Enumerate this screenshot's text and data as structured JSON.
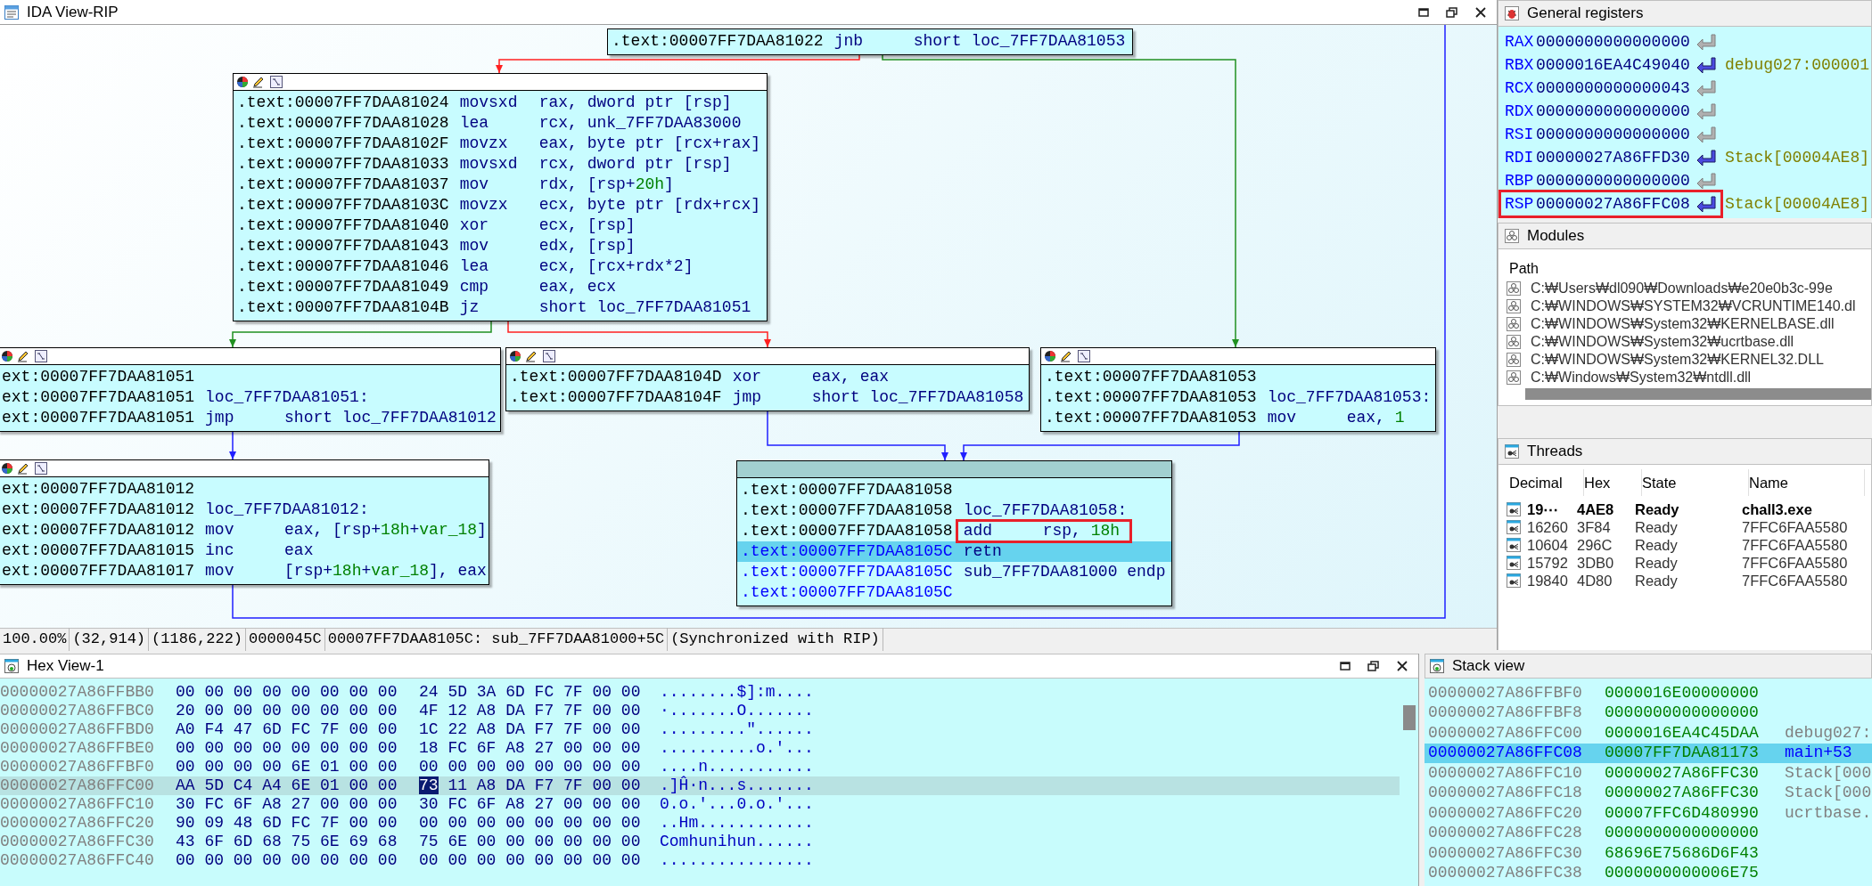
{
  "ida_view": {
    "title": "IDA View-RIP",
    "graph": {
      "nodes": [
        {
          "header": false,
          "lines": [
            {
              "address": ".text:00007FF7DAA81022",
              "mnemonic": "jnb",
              "operands": [
                {
                  "text": "short loc_7FF7DAA81053"
                }
              ]
            }
          ]
        },
        {
          "header": true,
          "lines": [
            {
              "address": ".text:00007FF7DAA81024",
              "mnemonic": "movsxd",
              "operands": [
                {
                  "text": "rax, dword ptr [rsp]"
                }
              ]
            },
            {
              "address": ".text:00007FF7DAA81028",
              "mnemonic": "lea",
              "operands": [
                {
                  "text": "rcx, unk_7FF7DAA83000"
                }
              ]
            },
            {
              "address": ".text:00007FF7DAA8102F",
              "mnemonic": "movzx",
              "operands": [
                {
                  "text": "eax, byte ptr [rcx+rax]"
                }
              ]
            },
            {
              "address": ".text:00007FF7DAA81033",
              "mnemonic": "movsxd",
              "operands": [
                {
                  "text": "rcx, dword ptr [rsp]"
                }
              ]
            },
            {
              "address": ".text:00007FF7DAA81037",
              "mnemonic": "mov",
              "operands": [
                {
                  "text": "rdx, [rsp+"
                },
                {
                  "text": "20h",
                  "kind": "number"
                },
                {
                  "text": "]"
                }
              ]
            },
            {
              "address": ".text:00007FF7DAA8103C",
              "mnemonic": "movzx",
              "operands": [
                {
                  "text": "ecx, byte ptr [rdx+rcx]"
                }
              ]
            },
            {
              "address": ".text:00007FF7DAA81040",
              "mnemonic": "xor",
              "operands": [
                {
                  "text": "ecx, [rsp]"
                }
              ]
            },
            {
              "address": ".text:00007FF7DAA81043",
              "mnemonic": "mov",
              "operands": [
                {
                  "text": "edx, [rsp]"
                }
              ]
            },
            {
              "address": ".text:00007FF7DAA81046",
              "mnemonic": "lea",
              "operands": [
                {
                  "text": "ecx, [rcx+rdx*2]"
                }
              ]
            },
            {
              "address": ".text:00007FF7DAA81049",
              "mnemonic": "cmp",
              "operands": [
                {
                  "text": "eax, ecx"
                }
              ]
            },
            {
              "address": ".text:00007FF7DAA8104B",
              "mnemonic": "jz",
              "operands": [
                {
                  "text": "short loc_7FF7DAA81051"
                }
              ]
            }
          ]
        },
        {
          "header": true,
          "lines": [
            {
              "address": "ext:00007FF7DAA81051"
            },
            {
              "address": "ext:00007FF7DAA81051",
              "label": "loc_7FF7DAA81051:"
            },
            {
              "address": "ext:00007FF7DAA81051",
              "mnemonic": "jmp",
              "operands": [
                {
                  "text": "short loc_7FF7DAA81012"
                }
              ]
            }
          ]
        },
        {
          "header": true,
          "lines": [
            {
              "address": ".text:00007FF7DAA8104D",
              "mnemonic": "xor",
              "operands": [
                {
                  "text": "eax, eax"
                }
              ]
            },
            {
              "address": ".text:00007FF7DAA8104F",
              "mnemonic": "jmp",
              "operands": [
                {
                  "text": "short loc_7FF7DAA81058"
                }
              ]
            }
          ]
        },
        {
          "header": true,
          "lines": [
            {
              "address": ".text:00007FF7DAA81053"
            },
            {
              "address": ".text:00007FF7DAA81053",
              "label": "loc_7FF7DAA81053:"
            },
            {
              "address": ".text:00007FF7DAA81053",
              "mnemonic": "mov",
              "operands": [
                {
                  "text": "eax, "
                },
                {
                  "text": "1",
                  "kind": "number"
                }
              ]
            }
          ]
        },
        {
          "header": true,
          "lines": [
            {
              "address": "ext:00007FF7DAA81012"
            },
            {
              "address": "ext:00007FF7DAA81012",
              "label": "loc_7FF7DAA81012:"
            },
            {
              "address": "ext:00007FF7DAA81012",
              "mnemonic": "mov",
              "operands": [
                {
                  "text": "eax, [rsp+"
                },
                {
                  "text": "18h",
                  "kind": "number"
                },
                {
                  "text": "+"
                },
                {
                  "text": "var_18",
                  "kind": "number"
                },
                {
                  "text": "]"
                }
              ]
            },
            {
              "address": "ext:00007FF7DAA81015",
              "mnemonic": "inc",
              "operands": [
                {
                  "text": "eax"
                }
              ]
            },
            {
              "address": "ext:00007FF7DAA81017",
              "mnemonic": "mov",
              "operands": [
                {
                  "text": "[rsp+"
                },
                {
                  "text": "18h",
                  "kind": "number"
                },
                {
                  "text": "+"
                },
                {
                  "text": "var_18",
                  "kind": "number"
                },
                {
                  "text": "], eax"
                }
              ]
            }
          ]
        },
        {
          "header": true,
          "current": true,
          "lines": [
            {
              "address": ".text:00007FF7DAA81058",
              "selected": false,
              "current": false
            },
            {
              "address": ".text:00007FF7DAA81058",
              "label": "loc_7FF7DAA81058:",
              "selected": false,
              "current": false
            },
            {
              "address": ".text:00007FF7DAA81058",
              "mnemonic": "add",
              "operands": [
                {
                  "text": "rsp, "
                },
                {
                  "text": "18h",
                  "kind": "number"
                }
              ],
              "selected": false,
              "current": false,
              "annotated": true
            },
            {
              "address": ".text:00007FF7DAA8105C",
              "mnemonic": "retn",
              "selected": true,
              "current": true
            },
            {
              "address": ".text:00007FF7DAA8105C",
              "label": "sub_7FF7DAA81000 endp",
              "selected": false,
              "current": true
            },
            {
              "address": ".text:00007FF7DAA8105C",
              "selected": false,
              "current": true
            }
          ]
        }
      ]
    },
    "status_bar": [
      "100.00%",
      "(32,914)",
      "(1186,222)",
      "0000045C",
      "00007FF7DAA8105C: sub_7FF7DAA81000+5C",
      "(Synchronized with RIP)"
    ]
  },
  "general_registers": {
    "title": "General registers",
    "registers": [
      {
        "name": "RAX",
        "value": "0000000000000000",
        "pointer": false
      },
      {
        "name": "RBX",
        "value": "0000016EA4C49040",
        "pointer": true,
        "comment": "debug027:000001"
      },
      {
        "name": "RCX",
        "value": "0000000000000043",
        "pointer": false
      },
      {
        "name": "RDX",
        "value": "0000000000000000",
        "pointer": false
      },
      {
        "name": "RSI",
        "value": "0000000000000000",
        "pointer": false
      },
      {
        "name": "RDI",
        "value": "00000027A86FFD30",
        "pointer": true,
        "comment": "Stack[00004AE8]"
      },
      {
        "name": "RBP",
        "value": "0000000000000000",
        "pointer": false
      },
      {
        "name": "RSP",
        "value": "00000027A86FFC08",
        "pointer": true,
        "comment": "Stack[00004AE8]",
        "annotated": true
      }
    ]
  },
  "modules": {
    "title": "Modules",
    "column": "Path",
    "rows": [
      "C:₩Users₩dl090₩Downloads₩e20e0b3c-99e",
      "C:₩WINDOWS₩SYSTEM32₩VCRUNTIME140.dl",
      "C:₩WINDOWS₩System32₩KERNELBASE.dll",
      "C:₩WINDOWS₩System32₩ucrtbase.dll",
      "C:₩WINDOWS₩System32₩KERNEL32.DLL",
      "C:₩Windows₩System32₩ntdll.dll"
    ]
  },
  "threads": {
    "title": "Threads",
    "columns": [
      "Decimal",
      "Hex",
      "State",
      "Name"
    ],
    "rows": [
      {
        "cells": [
          "19⋯",
          "4AE8",
          "Ready",
          "chall3.exe"
        ],
        "current": true
      },
      {
        "cells": [
          "16260",
          "3F84",
          "Ready",
          "7FFC6FAA5580"
        ],
        "current": false
      },
      {
        "cells": [
          "10604",
          "296C",
          "Ready",
          "7FFC6FAA5580"
        ],
        "current": false
      },
      {
        "cells": [
          "15792",
          "3DB0",
          "Ready",
          "7FFC6FAA5580"
        ],
        "current": false
      },
      {
        "cells": [
          "19840",
          "4D80",
          "Ready",
          "7FFC6FAA5580"
        ],
        "current": false
      }
    ]
  },
  "hex_view": {
    "title": "Hex View-1",
    "rows": [
      {
        "address": "00000027A86FFBB0",
        "bytes": [
          "00 00 00 00 00 00 00 00",
          "24 5D 3A 6D FC 7F 00 00"
        ],
        "ascii": "........$]:m....",
        "selected": false,
        "cursor": false
      },
      {
        "address": "00000027A86FFBC0",
        "bytes": [
          "20 00 00 00 00 00 00 00",
          "4F 12 A8 DA F7 7F 00 00"
        ],
        "ascii": "·.......O.......",
        "selected": false,
        "cursor": false
      },
      {
        "address": "00000027A86FFBD0",
        "bytes": [
          "A0 F4 47 6D FC 7F 00 00",
          "1C 22 A8 DA F7 7F 00 00"
        ],
        "ascii": ".........\"......",
        "selected": false,
        "cursor": false
      },
      {
        "address": "00000027A86FFBE0",
        "bytes": [
          "00 00 00 00 00 00 00 00",
          "18 FC 6F A8 27 00 00 00"
        ],
        "ascii": "..........o.'...",
        "selected": false,
        "cursor": false
      },
      {
        "address": "00000027A86FFBF0",
        "bytes": [
          "00 00 00 00 6E 01 00 00",
          "00 00 00 00 00 00 00 00"
        ],
        "ascii": "....n...........",
        "selected": false,
        "cursor": false
      },
      {
        "address": "00000027A86FFC00",
        "bytes": [
          "AA 5D C4 A4 6E 01 00 00",
          "73 11 A8 DA F7 7F 00 00"
        ],
        "ascii": ".]Ĥ·n...s.......",
        "selected": true,
        "cursor": true
      },
      {
        "address": "00000027A86FFC10",
        "bytes": [
          "30 FC 6F A8 27 00 00 00",
          "30 FC 6F A8 27 00 00 00"
        ],
        "ascii": "0.o.'...0.o.'...",
        "selected": false,
        "cursor": false
      },
      {
        "address": "00000027A86FFC20",
        "bytes": [
          "90 09 48 6D FC 7F 00 00",
          "00 00 00 00 00 00 00 00"
        ],
        "ascii": "..Hm............",
        "selected": false,
        "cursor": false
      },
      {
        "address": "00000027A86FFC30",
        "bytes": [
          "43 6F 6D 68 75 6E 69 68",
          "75 6E 00 00 00 00 00 00"
        ],
        "ascii": "Comhunihun......",
        "selected": false,
        "cursor": false
      },
      {
        "address": "00000027A86FFC40",
        "bytes": [
          "00 00 00 00 00 00 00 00",
          "00 00 00 00 00 00 00 00"
        ],
        "ascii": "................",
        "selected": false,
        "cursor": false
      }
    ]
  },
  "stack_view": {
    "title": "Stack view",
    "rows": [
      {
        "address": "00000027A86FFBF0",
        "value": "0000016E00000000",
        "selected": false
      },
      {
        "address": "00000027A86FFBF8",
        "value": "0000000000000000",
        "selected": false
      },
      {
        "address": "00000027A86FFC00",
        "value": "0000016EA4C45DAA",
        "comment": "debug027:",
        "selected": false
      },
      {
        "address": "00000027A86FFC08",
        "value": "00007FF7DAA81173",
        "comment": "main+53",
        "selected": true
      },
      {
        "address": "00000027A86FFC10",
        "value": "00000027A86FFC30",
        "comment": "Stack[000",
        "selected": false
      },
      {
        "address": "00000027A86FFC18",
        "value": "00000027A86FFC30",
        "comment": "Stack[000",
        "selected": false
      },
      {
        "address": "00000027A86FFC20",
        "value": "00007FFC6D480990",
        "comment": "ucrtbase.",
        "selected": false
      },
      {
        "address": "00000027A86FFC28",
        "value": "0000000000000000",
        "selected": false
      },
      {
        "address": "00000027A86FFC30",
        "value": "68696E75686D6F43",
        "selected": false
      },
      {
        "address": "00000027A86FFC38",
        "value": "0000000000006E75",
        "selected": false
      }
    ]
  }
}
